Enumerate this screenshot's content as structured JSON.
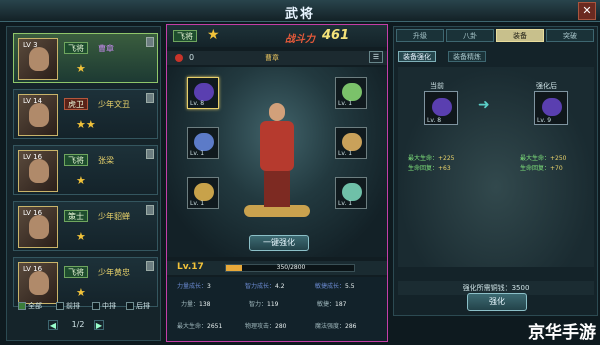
{
  "window": {
    "title": "武将",
    "close_glyph": "✕"
  },
  "hero_list": {
    "heroes": [
      {
        "level": "LV 3",
        "rank": "飞将",
        "name": "曹章",
        "stars": "★",
        "rank_color": "green",
        "selected": true
      },
      {
        "level": "LV 14",
        "rank": "虎卫",
        "name": "少年文丑",
        "stars": "★★",
        "rank_color": "red",
        "selected": false
      },
      {
        "level": "LV 16",
        "rank": "飞将",
        "name": "张梁",
        "stars": "★",
        "rank_color": "green",
        "selected": false
      },
      {
        "level": "LV 16",
        "rank": "策士",
        "name": "少年貂蝉",
        "stars": "★",
        "rank_color": "green",
        "selected": false
      },
      {
        "level": "LV 16",
        "rank": "飞将",
        "name": "少年黄忠",
        "stars": "★",
        "rank_color": "green",
        "selected": false
      }
    ],
    "filters": [
      {
        "label": "全部",
        "checked": true
      },
      {
        "label": "前排",
        "checked": false
      },
      {
        "label": "中排",
        "checked": false
      },
      {
        "label": "后排",
        "checked": false
      }
    ],
    "pager": {
      "prev": "◀",
      "next": "▶",
      "page": "1/2"
    }
  },
  "hero_detail": {
    "rank": "飞将",
    "star": "★",
    "power_label": "战斗力",
    "power_value": "461",
    "resource_value": "0",
    "name_label": "曹章",
    "corner_icon": "☰",
    "equip_slots_left": [
      {
        "level": "Lv. 8",
        "icon": "sash-icon",
        "color": "#5a3fb0",
        "highlight": true
      },
      {
        "level": "Lv. 1",
        "icon": "lance-icon",
        "color": "#5c7bc8",
        "highlight": false
      },
      {
        "level": "Lv. 1",
        "icon": "drum-icon",
        "color": "#c8a24a",
        "highlight": false
      }
    ],
    "equip_slots_right": [
      {
        "level": "Lv. 1",
        "icon": "jade-icon",
        "color": "#7bc26a",
        "highlight": false
      },
      {
        "level": "Lv. 1",
        "icon": "robe-icon",
        "color": "#c9a15a",
        "highlight": false
      },
      {
        "level": "Lv. 1",
        "icon": "boot-icon",
        "color": "#6fc0a8",
        "highlight": false
      }
    ],
    "enhance_one_label": "一键强化",
    "level": "Lv.17",
    "exp_text": "350/2800",
    "exp_fraction": 0.125,
    "stats": {
      "grow_power_label": "力量成长：",
      "grow_power": "3",
      "grow_int_label": "智力成长：",
      "grow_int": "4.2",
      "grow_agi_label": "敏捷成长：",
      "grow_agi": "5.5",
      "str_label": "力量：",
      "str": "138",
      "int_label": "智力：",
      "int": "119",
      "agi_label": "敏捷：",
      "agi": "187",
      "hp_label": "最大生命：",
      "hp": "2651",
      "atk_label": "物理攻击：",
      "atk": "280",
      "mdef_label": "魔法强度：",
      "mdef": "286"
    }
  },
  "right_panel": {
    "tabs": [
      {
        "label": "升级",
        "active": false
      },
      {
        "label": "八卦",
        "active": false
      },
      {
        "label": "装备",
        "active": true
      },
      {
        "label": "突破",
        "active": false
      }
    ],
    "subtabs": [
      {
        "label": "装备强化",
        "active": true
      },
      {
        "label": "装备精炼",
        "active": false
      }
    ],
    "before_label": "当前",
    "after_label": "强化后",
    "before_level": "Lv. 8",
    "after_level": "Lv. 9",
    "before_stats": [
      {
        "label": "最大生命：",
        "value": "+225"
      },
      {
        "label": "生命回复：",
        "value": "+63"
      }
    ],
    "after_stats": [
      {
        "label": "最大生命：",
        "value": "+250"
      },
      {
        "label": "生命回复：",
        "value": "+70"
      }
    ],
    "cost_label": "强化所需铜钱：",
    "cost_value": "3500",
    "enhance_label": "强化"
  },
  "watermark": "京华手游",
  "colors": {
    "accent_gold": "#f2c33a",
    "selected_border": "#c43ea8",
    "stat_green": "#7ee07a"
  }
}
